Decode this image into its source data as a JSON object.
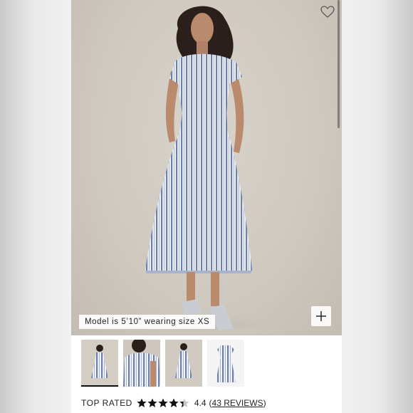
{
  "product": {
    "model_caption": "Model is 5’10” wearing size XS",
    "zoom_icon": "plus-icon",
    "favorite_icon": "heart-icon"
  },
  "gallery": {
    "thumbnails": [
      {
        "name": "full-front",
        "selected": true
      },
      {
        "name": "detail-shoulder",
        "selected": false
      },
      {
        "name": "full-back",
        "selected": false
      },
      {
        "name": "flat-lay",
        "selected": false
      }
    ]
  },
  "rating": {
    "label": "TOP RATED",
    "stars": 4.4,
    "value": "4.4",
    "open_paren": "(",
    "reviews_link": "43 REVIEWS",
    "close_paren": ")"
  },
  "colors": {
    "stripe_blue": "#6f84b0",
    "fabric_white": "#f2f3f6",
    "backdrop": "#d2ccc3"
  }
}
